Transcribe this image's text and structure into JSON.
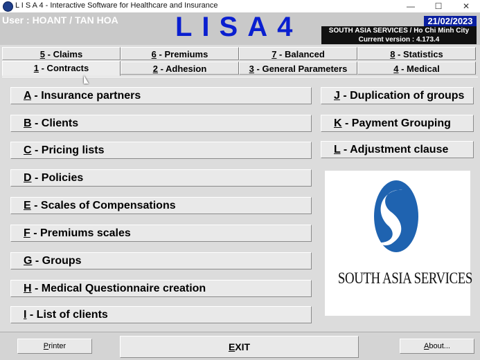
{
  "window": {
    "title": "L I S A 4 - Interactive Software for Healthcare and Insurance",
    "minimize": "—",
    "maximize": "☐",
    "close": "✕"
  },
  "header": {
    "user": "User : HOANT / TAN HOA",
    "logo": "LISA4",
    "date": "21/02/2023",
    "company": "SOUTH ASIA SERVICES / Ho Chi Minh City",
    "version": "Current version : 4.173.4"
  },
  "tabs_top": [
    {
      "key": "5",
      "label": " - Claims"
    },
    {
      "key": "6",
      "label": " - Premiums"
    },
    {
      "key": "7",
      "label": " - Balanced"
    },
    {
      "key": "8",
      "label": " - Statistics"
    }
  ],
  "tabs_bottom": [
    {
      "key": "1",
      "label": " - Contracts"
    },
    {
      "key": "2",
      "label": " - Adhesion"
    },
    {
      "key": "3",
      "label": " - General Parameters"
    },
    {
      "key": "4",
      "label": " - Medical"
    }
  ],
  "menu_left": [
    {
      "key": "A",
      "label": " - Insurance partners"
    },
    {
      "key": "B",
      "label": " - Clients"
    },
    {
      "key": "C",
      "label": " - Pricing lists"
    },
    {
      "key": "D",
      "label": " - Policies"
    },
    {
      "key": "E",
      "label": " - Scales of Compensations"
    },
    {
      "key": "F",
      "label": " - Premiums scales"
    },
    {
      "key": "G",
      "label": " - Groups"
    },
    {
      "key": "H",
      "label": " - Medical Questionnaire creation"
    },
    {
      "key": "I",
      "label": " - List of clients"
    }
  ],
  "menu_right": [
    {
      "key": "J",
      "label": " - Duplication of groups"
    },
    {
      "key": "K",
      "label": " - Payment Grouping"
    },
    {
      "key": "L",
      "label": " - Adjustment clause"
    }
  ],
  "brand": {
    "name": "SOUTH ASIA SERVICES"
  },
  "footer": {
    "printer": {
      "key": "P",
      "label": "rinter"
    },
    "exit": {
      "key": "E",
      "label": "XIT"
    },
    "about": {
      "key": "A",
      "label": "bout..."
    }
  },
  "colors": {
    "logo_blue": "#0a1fd0",
    "date_bg": "#0a1fa0",
    "brand_blue": "#1f63b0"
  }
}
